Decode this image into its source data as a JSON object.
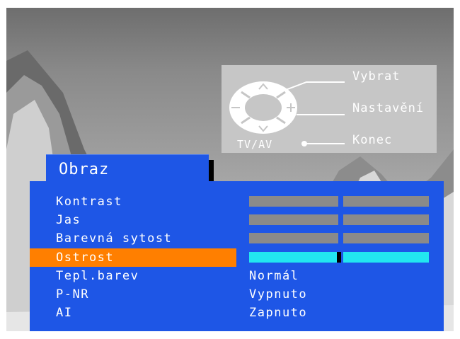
{
  "help_panel": {
    "select_label": "Vybrat",
    "adjust_label": "Nastavění",
    "exit_label": "Konec",
    "tvav_label": "TV/AV",
    "panel_color": "#c6c6c6"
  },
  "menu": {
    "title": "Obraz",
    "accent_color": "#1e56e6",
    "highlight_color": "#ff7f00",
    "items": [
      {
        "label": "Kontrast",
        "type": "bar",
        "level": 0.5,
        "active": false
      },
      {
        "label": "Jas",
        "type": "bar",
        "level": 0.5,
        "active": false
      },
      {
        "label": "Barevná sytost",
        "type": "bar",
        "level": 0.5,
        "active": false
      },
      {
        "label": "Ostrost",
        "type": "bar",
        "level": 0.5,
        "active": true,
        "selected": true
      },
      {
        "label": "Tepl.barev",
        "type": "value",
        "value": "Normál"
      },
      {
        "label": "P-NR",
        "type": "value",
        "value": "Vypnuto"
      },
      {
        "label": "AI",
        "type": "value",
        "value": "Zapnuto"
      }
    ]
  }
}
